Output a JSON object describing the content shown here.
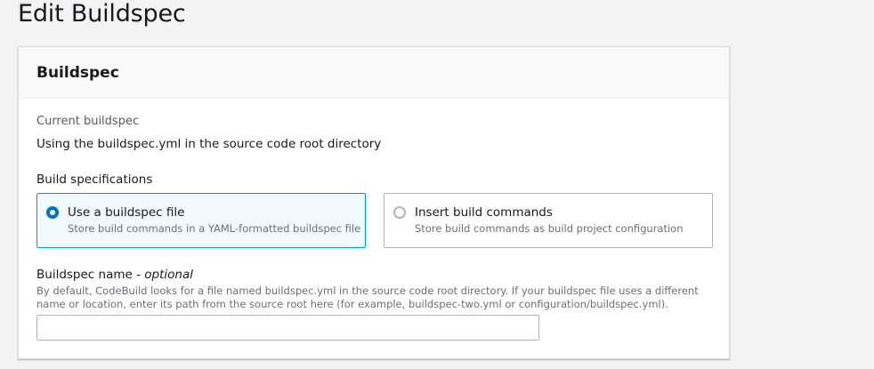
{
  "page": {
    "title": "Edit Buildspec"
  },
  "panel": {
    "title": "Buildspec",
    "current_label": "Current buildspec",
    "current_value": "Using the buildspec.yml in the source code root directory",
    "specs_label": "Build specifications",
    "options": [
      {
        "title": "Use a buildspec file",
        "description": "Store build commands in a YAML-formatted buildspec file",
        "selected": true
      },
      {
        "title": "Insert build commands",
        "description": "Store build commands as build project configuration",
        "selected": false
      }
    ],
    "name_label": "Buildspec name - ",
    "name_optional": "optional",
    "name_description": "By default, CodeBuild looks for a file named buildspec.yml in the source code root directory. If your buildspec file uses a different name or location, enter its path from the source root here (for example, buildspec-two.yml or configuration/buildspec.yml).",
    "name_value": "",
    "name_placeholder": ""
  },
  "colors": {
    "accent": "#0073bb",
    "selected_border": "#00a1c9",
    "selected_bg": "#f1faff"
  }
}
